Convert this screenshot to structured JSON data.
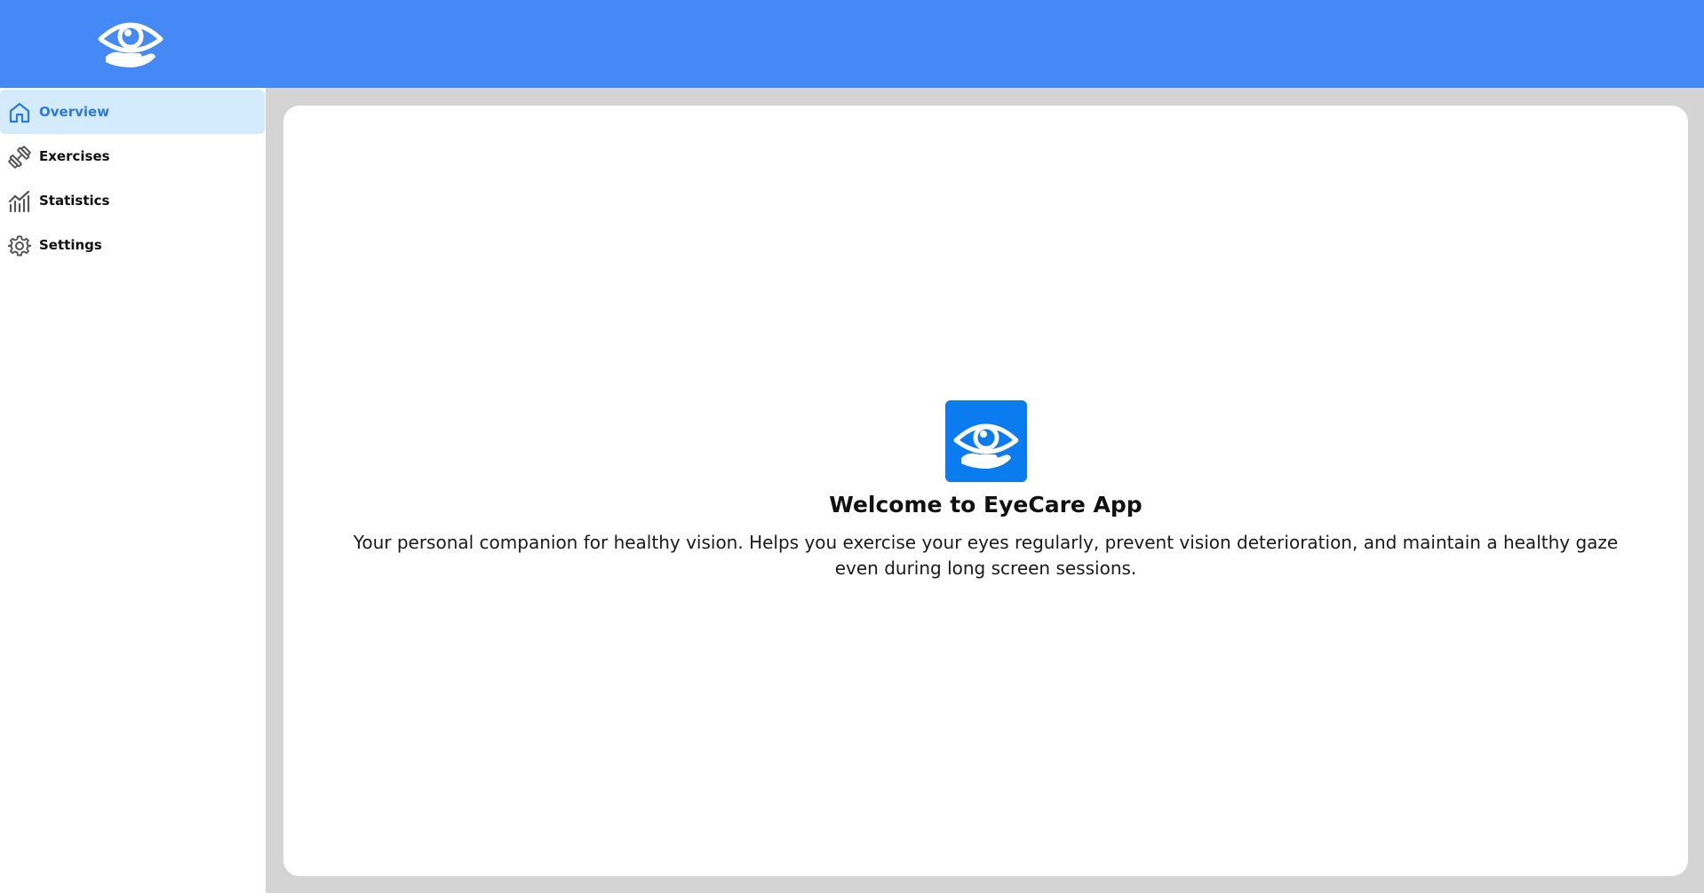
{
  "colors": {
    "header_bg": "#4589f7",
    "sidebar_bg": "#ffffff",
    "active_item_bg": "#d3ebfc",
    "active_item_text": "#2a7ae2",
    "app_logo_bg": "#0a7cf0",
    "page_bg": "#d4d4d4"
  },
  "header": {
    "logo_icon": "eye-in-hand-icon"
  },
  "sidebar": {
    "items": [
      {
        "label": "Overview",
        "icon": "home-icon",
        "active": true
      },
      {
        "label": "Exercises",
        "icon": "dumbbell-icon",
        "active": false
      },
      {
        "label": "Statistics",
        "icon": "chart-icon",
        "active": false
      },
      {
        "label": "Settings",
        "icon": "gear-icon",
        "active": false
      }
    ]
  },
  "main": {
    "logo_icon": "eye-in-hand-icon",
    "title": "Welcome to EyeCare App",
    "description": "Your personal companion for healthy vision. Helps you exercise your eyes regularly, prevent vision deterioration, and maintain a healthy gaze even during long screen sessions."
  }
}
